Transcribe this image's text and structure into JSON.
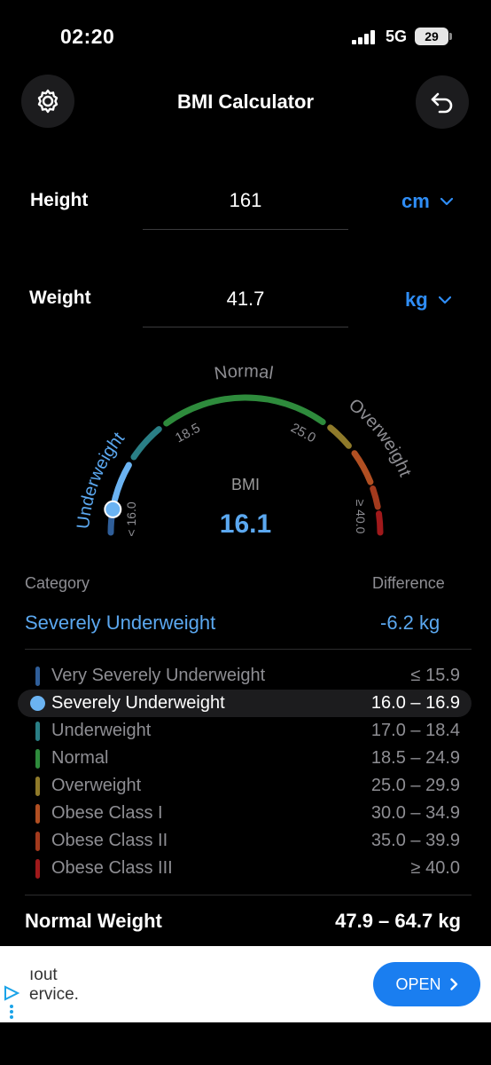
{
  "status": {
    "time": "02:20",
    "network": "5G",
    "battery": "29"
  },
  "header": {
    "title": "BMI Calculator"
  },
  "inputs": {
    "height": {
      "label": "Height",
      "value": "161",
      "unit": "cm"
    },
    "weight": {
      "label": "Weight",
      "value": "41.7",
      "unit": "kg"
    }
  },
  "gauge": {
    "label": "BMI",
    "value": "16.1",
    "pointer_bmi": 16.1,
    "labels": {
      "underweight": "Underweight",
      "normal": "Normal",
      "overweight": "Overweight"
    },
    "ticks": {
      "low": "< 16.0",
      "t1": "18.5",
      "t2": "25.0",
      "high": "≥ 40.0"
    },
    "colors": {
      "very_severe": "#2f5e99",
      "severe": "#6bb3f2",
      "under": "#2a7f86",
      "normal": "#2e8b3c",
      "over": "#8f7a2a",
      "obese1": "#b14f22",
      "obese2": "#a33a1d",
      "obese3": "#a0191b"
    }
  },
  "result": {
    "category_header": "Category",
    "difference_header": "Difference",
    "category": "Severely Underweight",
    "difference": "-6.2 kg"
  },
  "bmi_table": [
    {
      "name": "Very Severely Underweight",
      "range": "≤ 15.9",
      "color": "#2f5e99",
      "active": false
    },
    {
      "name": "Severely Underweight",
      "range": "16.0 – 16.9",
      "color": "#6bb3f2",
      "active": true
    },
    {
      "name": "Underweight",
      "range": "17.0 – 18.4",
      "color": "#2a7f86",
      "active": false
    },
    {
      "name": "Normal",
      "range": "18.5 – 24.9",
      "color": "#2e8b3c",
      "active": false
    },
    {
      "name": "Overweight",
      "range": "25.0 – 29.9",
      "color": "#8f7a2a",
      "active": false
    },
    {
      "name": "Obese Class I",
      "range": "30.0 – 34.9",
      "color": "#b14f22",
      "active": false
    },
    {
      "name": "Obese Class II",
      "range": "35.0 – 39.9",
      "color": "#a33a1d",
      "active": false
    },
    {
      "name": "Obese Class III",
      "range": "≥ 40.0",
      "color": "#a0191b",
      "active": false
    }
  ],
  "normal_weight": {
    "label": "Normal Weight",
    "value": "47.9 – 64.7 kg"
  },
  "ad": {
    "line1": "ıout",
    "line2": "ervice.",
    "button": "OPEN"
  }
}
